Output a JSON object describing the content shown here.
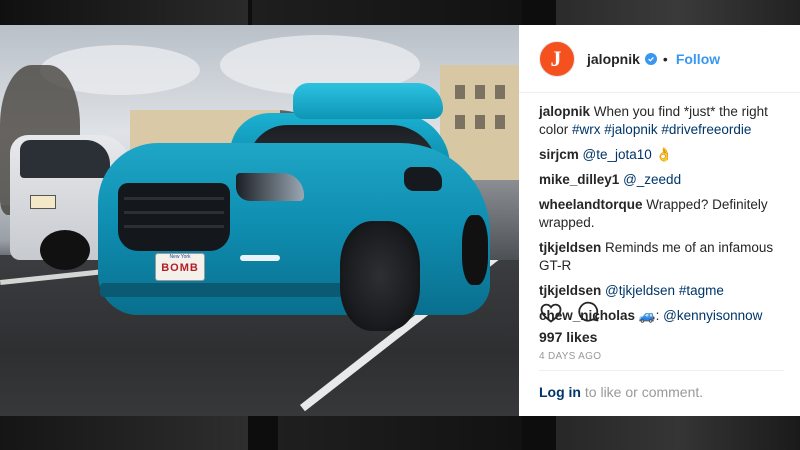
{
  "post": {
    "account": "jalopnik",
    "avatar_letter": "J",
    "follow_label": "Follow",
    "separator": "•",
    "verified": true,
    "plate": {
      "top": "New York",
      "main": "BOMB"
    },
    "comments": [
      {
        "user": "jalopnik",
        "parts": [
          {
            "t": "When you find *just* the right color ",
            "k": "text"
          },
          {
            "t": "#wrx",
            "k": "tag"
          },
          {
            "t": " ",
            "k": "text"
          },
          {
            "t": "#jalopnik",
            "k": "tag"
          },
          {
            "t": " ",
            "k": "text"
          },
          {
            "t": "#drivefreeordie",
            "k": "tag"
          }
        ]
      },
      {
        "user": "sirjcm",
        "parts": [
          {
            "t": "@te_jota10",
            "k": "tag"
          },
          {
            "t": " 👌",
            "k": "text"
          }
        ]
      },
      {
        "user": "mike_dilley1",
        "parts": [
          {
            "t": "@_zeedd",
            "k": "tag"
          }
        ]
      },
      {
        "user": "wheelandtorque",
        "parts": [
          {
            "t": "Wrapped? Definitely wrapped.",
            "k": "text"
          }
        ]
      },
      {
        "user": "tjkjeldsen",
        "parts": [
          {
            "t": "Reminds me of an infamous GT-R",
            "k": "text"
          }
        ]
      },
      {
        "user": "tjkjeldsen",
        "parts": [
          {
            "t": "@tjkjeldsen",
            "k": "tag"
          },
          {
            "t": " ",
            "k": "text"
          },
          {
            "t": "#tagme",
            "k": "tag"
          }
        ]
      },
      {
        "user": "chew_nicholas",
        "parts": [
          {
            "t": "🚙: ",
            "k": "text"
          },
          {
            "t": "@kennyisonnow",
            "k": "tag"
          }
        ]
      }
    ],
    "likes": "997 likes",
    "age": "4 DAYS AGO",
    "login": {
      "link": "Log in",
      "rest": " to like or comment."
    }
  },
  "colors": {
    "accent": "#3897f0",
    "avatar_bg": "#f4511e",
    "tag": "#003569",
    "car": "#1fa6c6"
  },
  "icons": {
    "like": "heart-icon",
    "comment": "comment-bubble-icon",
    "verified": "verified-badge-icon"
  }
}
